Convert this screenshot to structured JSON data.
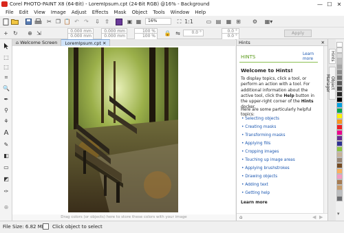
{
  "window": {
    "title": "Corel PHOTO-PAINT X8 (64-Bit) - LoremIpsum.cpt (24-Bit RGB) @16% - Background",
    "minimize": "—",
    "maximize": "☐",
    "close": "✕"
  },
  "menu": [
    "File",
    "Edit",
    "View",
    "Image",
    "Adjust",
    "Effects",
    "Mask",
    "Object",
    "Tools",
    "Window",
    "Help"
  ],
  "toolbar": {
    "zoom_value": "16%",
    "apply_label": "Apply"
  },
  "property_bar": {
    "pos_x": "0.000 mm",
    "pos_y": "0.000 mm",
    "width": "0.000 mm",
    "height": "0.000 mm",
    "scale_x": "100 %",
    "scale_y": "100 %",
    "rotation": "0.0 °",
    "skew_x": "0.0 °",
    "skew_y": "0.0 °"
  },
  "tabs": {
    "welcome": "Welcome Screen",
    "doc": "LoremIpsum.cpt"
  },
  "canvas_hint": "Drag colors (or objects) here to store these colors with your image",
  "docker": {
    "title": "Hints",
    "header": "HINTS",
    "learn_more_top": "Learn more",
    "welcome_heading": "Welcome to Hints!",
    "intro_part1": "To display topics, click a tool, or perform an action with a tool. For additional information about the active tool, click the ",
    "intro_help": "Help",
    "intro_part2": " button in the upper-right corner of the ",
    "intro_hints": "Hints",
    "intro_part3": " docker.",
    "topics_intro": "Here are some particularly helpful topics:",
    "topics": [
      "Selecting objects",
      "Creating masks",
      "Transforming masks",
      "Applying fills",
      "Cropping images",
      "Touching up image areas",
      "Applying brushstrokes",
      "Drawing objects",
      "Adding text",
      "Getting help"
    ],
    "learn_more_bottom": "Learn more"
  },
  "side_tabs": {
    "hints": "Hints",
    "object_manager": "Object Manager"
  },
  "palette": [
    "#ffffff",
    "#f2f2f2",
    "#d9d9d9",
    "#bfbfbf",
    "#a6a6a6",
    "#8c8c8c",
    "#737373",
    "#595959",
    "#404040",
    "#262626",
    "#000000",
    "#00a0e0",
    "#00a650",
    "#fff200",
    "#f7941d",
    "#ed1c24",
    "#ec008c",
    "#662d91",
    "#2e3192",
    "#8dc63f",
    "#c7b299",
    "#998675",
    "#754c24",
    "#fbaf5d",
    "#f49ac1",
    "#a67c52",
    "#c69c6d",
    "#bcbec0",
    "#6d6e71"
  ],
  "status": {
    "file_size": "File Size: 6.82 MB",
    "message": "Click object to select"
  }
}
